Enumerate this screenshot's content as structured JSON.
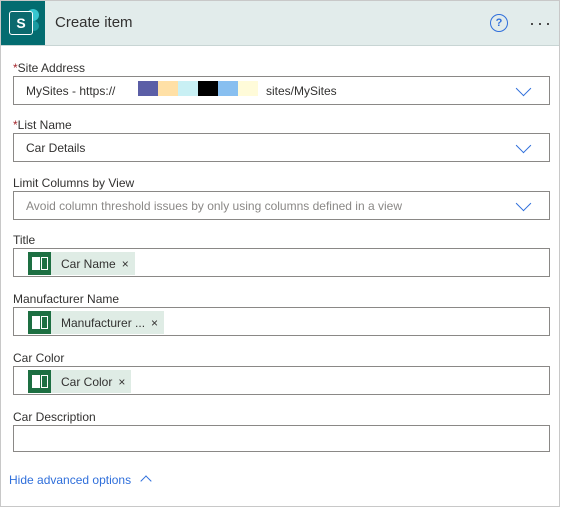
{
  "header": {
    "app_letter": "S",
    "title": "Create item",
    "help_glyph": "?",
    "more_glyph": "···"
  },
  "site_address": {
    "required_mark": "*",
    "label": "Site Address",
    "value_prefix": "MySites - https://",
    "value_suffix": "sites/MySites",
    "redaction_colors": [
      "#5b5ea6",
      "#ffe0a6",
      "#c9f0f4",
      "#000000",
      "#88bff0",
      "#fffbd9"
    ]
  },
  "list_name": {
    "required_mark": "*",
    "label": "List Name",
    "value": "Car Details"
  },
  "limit_columns": {
    "label": "Limit Columns by View",
    "placeholder": "Avoid column threshold issues by only using columns defined in a view"
  },
  "fields": [
    {
      "label": "Title",
      "token": "Car Name"
    },
    {
      "label": "Manufacturer Name",
      "token": "Manufacturer ..."
    },
    {
      "label": "Car Color",
      "token": "Car Color"
    }
  ],
  "car_description": {
    "label": "Car Description",
    "value": ""
  },
  "advanced": {
    "label": "Hide advanced options"
  },
  "icons": {
    "app": "sharepoint-icon",
    "token": "excel-icon",
    "remove": "close-icon",
    "dropdown": "chevron-down-icon"
  },
  "colors": {
    "accent": "#2f6fdb",
    "header_bg": "#e2eceb",
    "app_icon_bg": "#036c70",
    "excel_green": "#1d6f42",
    "token_bg": "#dfece5",
    "required": "#a4262c"
  },
  "token_remove_glyph": "×"
}
